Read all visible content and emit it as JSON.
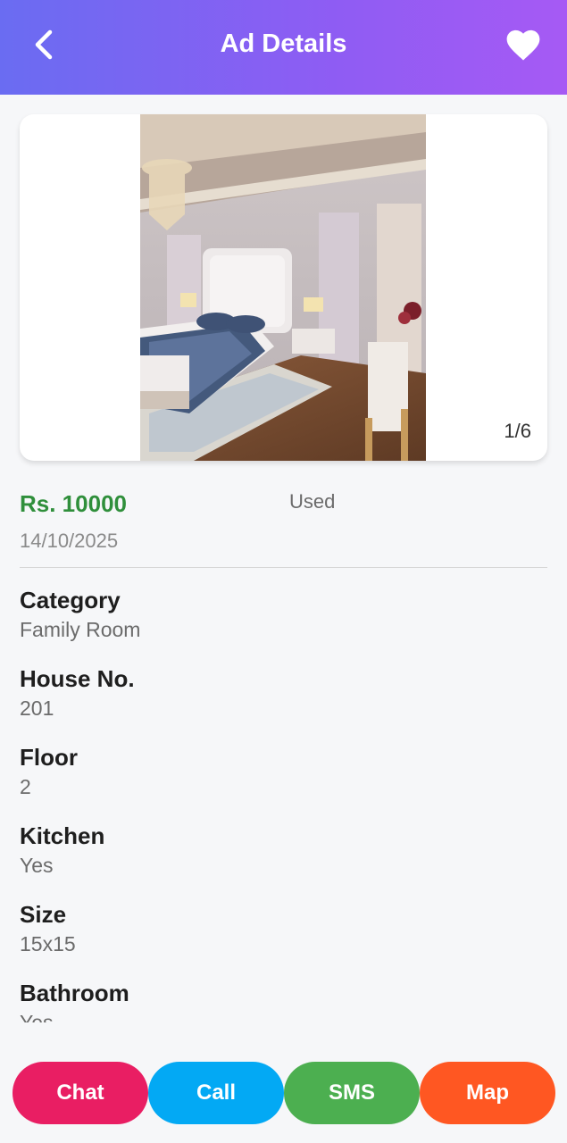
{
  "header": {
    "title": "Ad Details",
    "back_icon": "chevron-left-icon",
    "favorite_icon": "heart-icon"
  },
  "gallery": {
    "counter": "1/6",
    "image": "bedroom-photo"
  },
  "ad": {
    "price": "Rs. 10000",
    "condition": "Used",
    "date": "14/10/2025"
  },
  "details": [
    {
      "label": "Category",
      "value": "Family Room"
    },
    {
      "label": "House No.",
      "value": "201"
    },
    {
      "label": "Floor",
      "value": "2"
    },
    {
      "label": "Kitchen",
      "value": "Yes"
    },
    {
      "label": "Size",
      "value": "15x15"
    },
    {
      "label": "Bathroom",
      "value": "Yes"
    }
  ],
  "actions": {
    "chat": "Chat",
    "call": "Call",
    "sms": "SMS",
    "map": "Map"
  },
  "colors": {
    "header_start": "#6a6cf2",
    "header_end": "#a65af4",
    "price": "#2f8f3b",
    "chat": "#e91e63",
    "call": "#03a9f4",
    "sms": "#4caf50",
    "map": "#ff5722"
  }
}
